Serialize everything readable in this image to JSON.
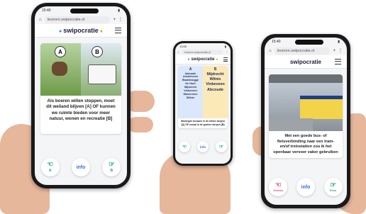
{
  "phone_left": {
    "status_time": "15:40",
    "url": "leveren.swipocratie.nl",
    "logo": "swipocratie",
    "option_a": "A",
    "option_b": "B",
    "caption": "Als boeren willen stoppen, moet dit weiland blijven [A] OF kunnen we ruimte bieden voor meer natuur, wonen en recreatie [B]",
    "btn_a": "A",
    "btn_info": "info",
    "btn_b": "B"
  },
  "phone_mid": {
    "status_time": "13:55",
    "url": "leveren.swipocratie.nl",
    "logo": "swipocratie",
    "col_a_label": "A",
    "col_b_label": "B",
    "col_a_items": [
      "Aalsmde",
      "Amstelveen",
      "Baambrugge",
      "De Hoef",
      "Mijdrecht",
      "Vinkeveen",
      "Waverveen",
      "Wilnis"
    ],
    "col_b_items": [
      "Mijdrecht",
      "Wilnis",
      "Vinkeveen",
      "Abcoude"
    ],
    "caption": "Woningen bouwen in de kleine dorpen [A] OF vooral in de grotere dorpen [B]",
    "btn_info": "info"
  },
  "phone_right": {
    "status_time": "15:40",
    "url": "leveren.swipocratie.nl",
    "logo": "swipocratie",
    "caption": "Met een goede bus- of fietsverbinding naar een tram- en/of treinstation zou ik het openbaar vervoer vaker gebruiken",
    "btn_left": "Oneens",
    "btn_info": "info",
    "btn_right": "Eens"
  },
  "colors": {
    "accent_blue": "#3b82f6",
    "accent_orange": "#f59e0b",
    "agree_green": "#1fa37a",
    "disagree_pink": "#ef476f"
  }
}
